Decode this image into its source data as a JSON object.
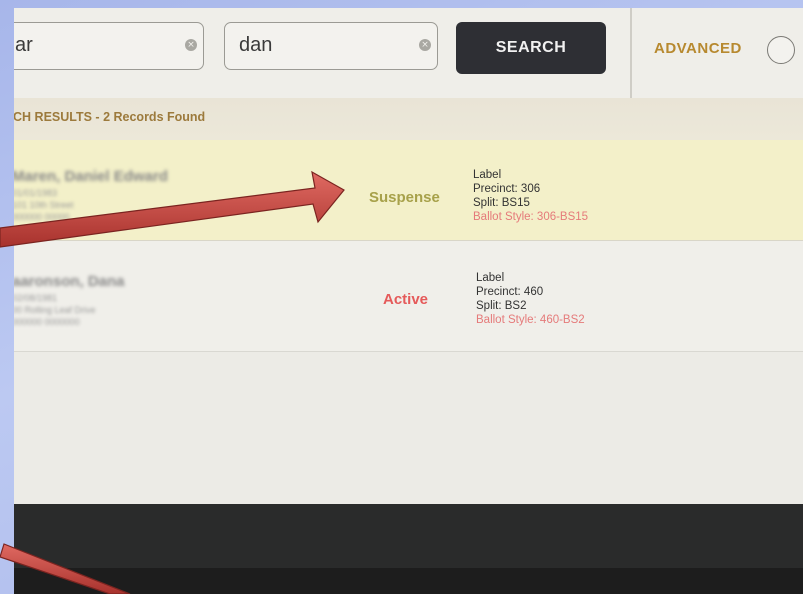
{
  "search": {
    "field1_value": "ar",
    "field2_value": "dan",
    "clear_glyph": "×",
    "button_label": "SEARCH",
    "advanced_label": "ADVANCED"
  },
  "results": {
    "header": "RCH RESULTS - 2 Records Found",
    "rows": [
      {
        "name": "Maren, Daniel Edward",
        "sub1": "01/01/1983",
        "sub2": "101 10th Street",
        "sub3": "000000 00000",
        "status": "Suspense",
        "detail_label": "Label",
        "precinct": "Precinct: 306",
        "split": "Split: BS15",
        "ballot": "Ballot Style: 306-BS15"
      },
      {
        "name": "aaronson, Dana",
        "sub1": "02/08/1981",
        "sub2": "00 Rolling Leaf Drive",
        "sub3": "000000 0000000",
        "status": "Active",
        "detail_label": "Label",
        "precinct": "Precinct: 460",
        "split": "Split: BS2",
        "ballot": "Ballot Style: 460-BS2"
      }
    ]
  },
  "colors": {
    "suspense": "#a7a14a",
    "active": "#e55a5a",
    "advanced": "#b7892f",
    "arrow": "#c44640"
  }
}
